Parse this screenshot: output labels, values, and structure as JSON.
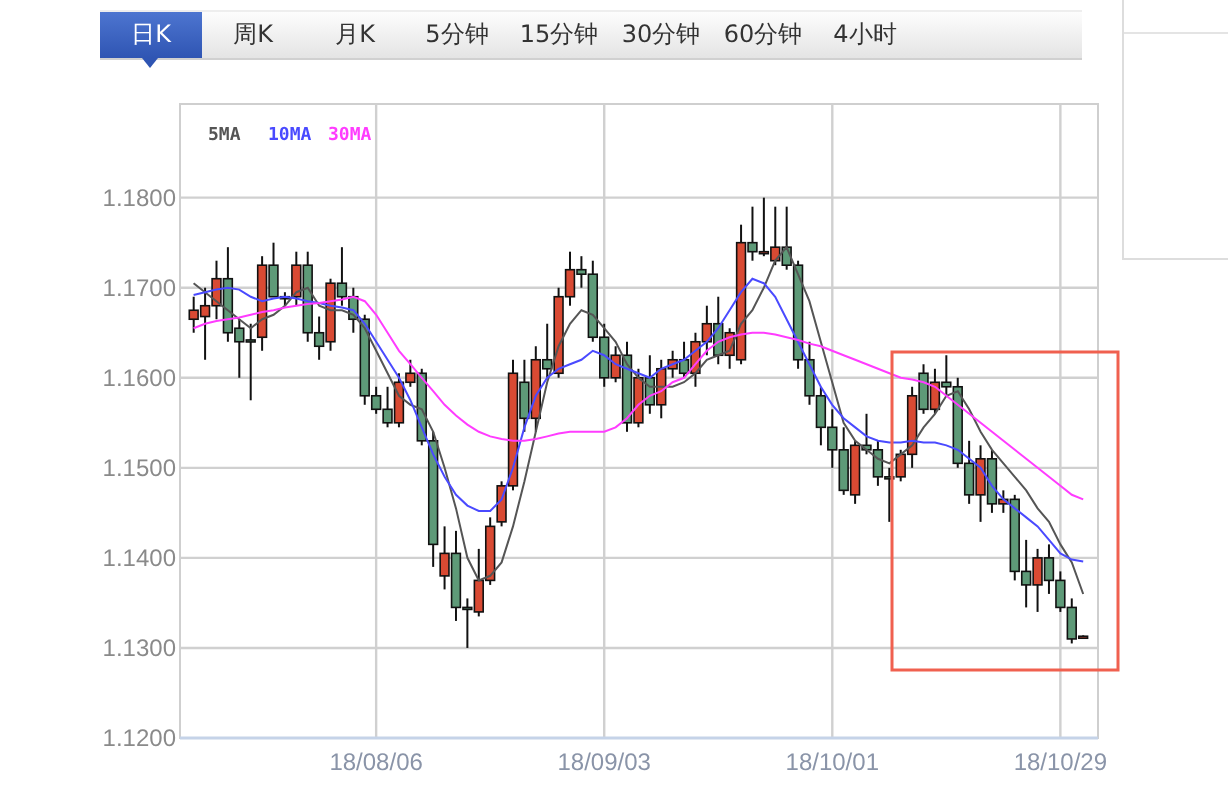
{
  "tabs": [
    {
      "label": "日K",
      "selected": true
    },
    {
      "label": "周K",
      "selected": false
    },
    {
      "label": "月K",
      "selected": false
    },
    {
      "label": "5分钟",
      "selected": false
    },
    {
      "label": "15分钟",
      "selected": false
    },
    {
      "label": "30分钟",
      "selected": false
    },
    {
      "label": "60分钟",
      "selected": false
    },
    {
      "label": "4小时",
      "selected": false
    }
  ],
  "chart": {
    "chart_data": {
      "type": "candlestick",
      "grid": true,
      "categories": [
        null,
        null,
        null,
        null,
        null,
        null,
        null,
        null,
        null,
        null,
        null,
        null,
        null,
        null,
        null,
        null,
        "18/08/06",
        null,
        null,
        null,
        null,
        null,
        null,
        null,
        null,
        null,
        null,
        null,
        null,
        null,
        null,
        null,
        null,
        null,
        null,
        null,
        "18/09/03",
        null,
        null,
        null,
        null,
        null,
        null,
        null,
        null,
        null,
        null,
        null,
        null,
        null,
        null,
        null,
        null,
        null,
        null,
        null,
        "18/10/01",
        null,
        null,
        null,
        null,
        null,
        null,
        null,
        null,
        null,
        null,
        null,
        null,
        null,
        null,
        null,
        null,
        null,
        null,
        null,
        "18/10/29",
        null,
        null
      ],
      "ylim": [
        1.12,
        1.1904
      ],
      "yticks": [
        {
          "value": 1.12,
          "label": "1.1200"
        },
        {
          "value": 1.13,
          "label": "1.1300"
        },
        {
          "value": 1.14,
          "label": "1.1400"
        },
        {
          "value": 1.15,
          "label": "1.1500"
        },
        {
          "value": 1.16,
          "label": "1.1600"
        },
        {
          "value": 1.17,
          "label": "1.1700"
        },
        {
          "value": 1.18,
          "label": "1.1800"
        }
      ],
      "series": [
        {
          "name": "5MA",
          "type": "line",
          "color": "#555555",
          "values": [
            1.1705,
            1.1695,
            1.1685,
            1.1675,
            1.1665,
            1.1655,
            1.1665,
            1.167,
            1.168,
            1.1695,
            1.17,
            1.168,
            1.1675,
            1.1675,
            1.167,
            1.1655,
            1.163,
            1.1605,
            1.158,
            1.157,
            1.1565,
            1.154,
            1.15,
            1.1455,
            1.14,
            1.1375,
            1.138,
            1.1395,
            1.1435,
            1.1485,
            1.154,
            1.1595,
            1.1635,
            1.166,
            1.1675,
            1.167,
            1.1655,
            1.164,
            1.1615,
            1.16,
            1.159,
            1.159,
            1.159,
            1.1595,
            1.1605,
            1.162,
            1.1625,
            1.163,
            1.166,
            1.1675,
            1.17,
            1.173,
            1.1745,
            1.1715,
            1.1685,
            1.164,
            1.1595,
            1.155,
            1.153,
            1.152,
            1.151,
            1.1505,
            1.1515,
            1.1525,
            1.1545,
            1.156,
            1.158,
            1.1585,
            1.1565,
            1.154,
            1.152,
            1.1505,
            1.149,
            1.1475,
            1.1455,
            1.144,
            1.1415,
            1.1395,
            1.136
          ]
        },
        {
          "name": "10MA",
          "type": "line",
          "color": "#4a4aff",
          "values": [
            1.1692,
            1.1695,
            1.1698,
            1.17,
            1.1698,
            1.169,
            1.1685,
            1.1688,
            1.169,
            1.1688,
            1.1685,
            1.1683,
            1.168,
            1.1678,
            1.1675,
            1.166,
            1.164,
            1.162,
            1.16,
            1.1575,
            1.1545,
            1.1515,
            1.149,
            1.147,
            1.1458,
            1.1452,
            1.1452,
            1.1465,
            1.15,
            1.1545,
            1.158,
            1.16,
            1.161,
            1.1615,
            1.162,
            1.163,
            1.1625,
            1.1615,
            1.161,
            1.1605,
            1.16,
            1.161,
            1.1615,
            1.162,
            1.163,
            1.164,
            1.1655,
            1.1675,
            1.1695,
            1.171,
            1.1705,
            1.169,
            1.1665,
            1.164,
            1.1615,
            1.159,
            1.157,
            1.1555,
            1.1545,
            1.1535,
            1.153,
            1.1528,
            1.1528,
            1.153,
            1.1528,
            1.1528,
            1.1525,
            1.152,
            1.151,
            1.15,
            1.148,
            1.1465,
            1.1455,
            1.1445,
            1.1435,
            1.142,
            1.1405,
            1.1398,
            1.1396
          ]
        },
        {
          "name": "30MA",
          "type": "line",
          "color": "#ff3cff",
          "values": [
            1.1655,
            1.166,
            1.1663,
            1.1665,
            1.1667,
            1.167,
            1.1673,
            1.1675,
            1.1678,
            1.168,
            1.1682,
            1.1683,
            1.1685,
            1.1687,
            1.169,
            1.1685,
            1.167,
            1.165,
            1.163,
            1.1615,
            1.16,
            1.1585,
            1.157,
            1.1558,
            1.1548,
            1.154,
            1.1535,
            1.1532,
            1.153,
            1.153,
            1.1532,
            1.1535,
            1.1538,
            1.154,
            1.154,
            1.154,
            1.154,
            1.1545,
            1.1555,
            1.157,
            1.158,
            1.1585,
            1.1595,
            1.16,
            1.1615,
            1.163,
            1.164,
            1.1645,
            1.1648,
            1.165,
            1.165,
            1.1648,
            1.1645,
            1.1642,
            1.1638,
            1.1635,
            1.163,
            1.1625,
            1.162,
            1.1615,
            1.161,
            1.1605,
            1.16,
            1.1598,
            1.1595,
            1.159,
            1.158,
            1.157,
            1.156,
            1.155,
            1.154,
            1.153,
            1.152,
            1.151,
            1.15,
            1.149,
            1.148,
            1.147,
            1.1465
          ]
        }
      ],
      "ohlc": [
        [
          1.1665,
          1.169,
          1.165,
          1.1675
        ],
        [
          1.1668,
          1.17,
          1.162,
          1.168
        ],
        [
          1.168,
          1.173,
          1.1665,
          1.171
        ],
        [
          1.171,
          1.1745,
          1.164,
          1.165
        ],
        [
          1.1655,
          1.1665,
          1.16,
          1.164
        ],
        [
          1.1642,
          1.166,
          1.1575,
          1.164
        ],
        [
          1.1645,
          1.1735,
          1.163,
          1.1725
        ],
        [
          1.1725,
          1.175,
          1.169,
          1.169
        ],
        [
          1.169,
          1.1695,
          1.168,
          1.1688
        ],
        [
          1.169,
          1.174,
          1.168,
          1.1725
        ],
        [
          1.1725,
          1.174,
          1.164,
          1.165
        ],
        [
          1.165,
          1.1668,
          1.162,
          1.1635
        ],
        [
          1.164,
          1.171,
          1.163,
          1.1705
        ],
        [
          1.1705,
          1.1745,
          1.168,
          1.169
        ],
        [
          1.169,
          1.17,
          1.165,
          1.1665
        ],
        [
          1.1665,
          1.167,
          1.157,
          1.158
        ],
        [
          1.158,
          1.159,
          1.156,
          1.1565
        ],
        [
          1.1565,
          1.159,
          1.1545,
          1.155
        ],
        [
          1.155,
          1.1605,
          1.1545,
          1.1595
        ],
        [
          1.1595,
          1.162,
          1.159,
          1.1605
        ],
        [
          1.1605,
          1.161,
          1.1525,
          1.153
        ],
        [
          1.153,
          1.154,
          1.139,
          1.1415
        ],
        [
          1.138,
          1.1435,
          1.1365,
          1.1405
        ],
        [
          1.1405,
          1.143,
          1.133,
          1.1345
        ],
        [
          1.1345,
          1.1355,
          1.13,
          1.1345
        ],
        [
          1.134,
          1.141,
          1.1335,
          1.1375
        ],
        [
          1.1375,
          1.1445,
          1.137,
          1.1435
        ],
        [
          1.144,
          1.1485,
          1.1435,
          1.148
        ],
        [
          1.148,
          1.162,
          1.1475,
          1.1605
        ],
        [
          1.1595,
          1.162,
          1.154,
          1.1555
        ],
        [
          1.1555,
          1.1635,
          1.154,
          1.162
        ],
        [
          1.162,
          1.166,
          1.16,
          1.161
        ],
        [
          1.1605,
          1.17,
          1.16,
          1.169
        ],
        [
          1.169,
          1.174,
          1.168,
          1.172
        ],
        [
          1.172,
          1.1735,
          1.17,
          1.1715
        ],
        [
          1.1715,
          1.173,
          1.164,
          1.1645
        ],
        [
          1.1645,
          1.166,
          1.159,
          1.16
        ],
        [
          1.16,
          1.1635,
          1.1595,
          1.1625
        ],
        [
          1.1625,
          1.164,
          1.154,
          1.155
        ],
        [
          1.155,
          1.161,
          1.1545,
          1.16
        ],
        [
          1.16,
          1.1625,
          1.156,
          1.157
        ],
        [
          1.157,
          1.162,
          1.1555,
          1.161
        ],
        [
          1.161,
          1.163,
          1.16,
          1.162
        ],
        [
          1.162,
          1.164,
          1.16,
          1.1605
        ],
        [
          1.1605,
          1.165,
          1.159,
          1.164
        ],
        [
          1.164,
          1.168,
          1.1625,
          1.166
        ],
        [
          1.166,
          1.169,
          1.1615,
          1.1625
        ],
        [
          1.1625,
          1.1655,
          1.161,
          1.165
        ],
        [
          1.162,
          1.177,
          1.1615,
          1.175
        ],
        [
          1.175,
          1.179,
          1.173,
          1.174
        ],
        [
          1.1738,
          1.18,
          1.1735,
          1.174
        ],
        [
          1.173,
          1.179,
          1.1725,
          1.1745
        ],
        [
          1.1745,
          1.179,
          1.172,
          1.1725
        ],
        [
          1.1725,
          1.173,
          1.161,
          1.162
        ],
        [
          1.162,
          1.164,
          1.157,
          1.158
        ],
        [
          1.158,
          1.159,
          1.1525,
          1.1545
        ],
        [
          1.1545,
          1.1565,
          1.15,
          1.152
        ],
        [
          1.152,
          1.1545,
          1.147,
          1.1475
        ],
        [
          1.147,
          1.153,
          1.146,
          1.1525
        ],
        [
          1.1525,
          1.156,
          1.1515,
          1.152
        ],
        [
          1.152,
          1.153,
          1.148,
          1.149
        ],
        [
          1.149,
          1.15,
          1.144,
          1.149
        ],
        [
          1.149,
          1.152,
          1.1485,
          1.1515
        ],
        [
          1.1515,
          1.159,
          1.15,
          1.158
        ],
        [
          1.1605,
          1.1615,
          1.156,
          1.1565
        ],
        [
          1.1565,
          1.161,
          1.156,
          1.1595
        ],
        [
          1.1595,
          1.1625,
          1.158,
          1.159
        ],
        [
          1.159,
          1.16,
          1.15,
          1.1505
        ],
        [
          1.1505,
          1.153,
          1.146,
          1.147
        ],
        [
          1.147,
          1.1525,
          1.144,
          1.151
        ],
        [
          1.151,
          1.152,
          1.145,
          1.146
        ],
        [
          1.146,
          1.1475,
          1.145,
          1.1465
        ],
        [
          1.1465,
          1.147,
          1.1375,
          1.1385
        ],
        [
          1.1385,
          1.142,
          1.1345,
          1.137
        ],
        [
          1.137,
          1.141,
          1.134,
          1.14
        ],
        [
          1.14,
          1.1415,
          1.136,
          1.1375
        ],
        [
          1.1375,
          1.1385,
          1.134,
          1.1345
        ],
        [
          1.1345,
          1.1355,
          1.1305,
          1.131
        ],
        [
          1.1312,
          1.1314,
          1.131,
          1.1313
        ]
      ]
    },
    "highlight_frame": true
  }
}
